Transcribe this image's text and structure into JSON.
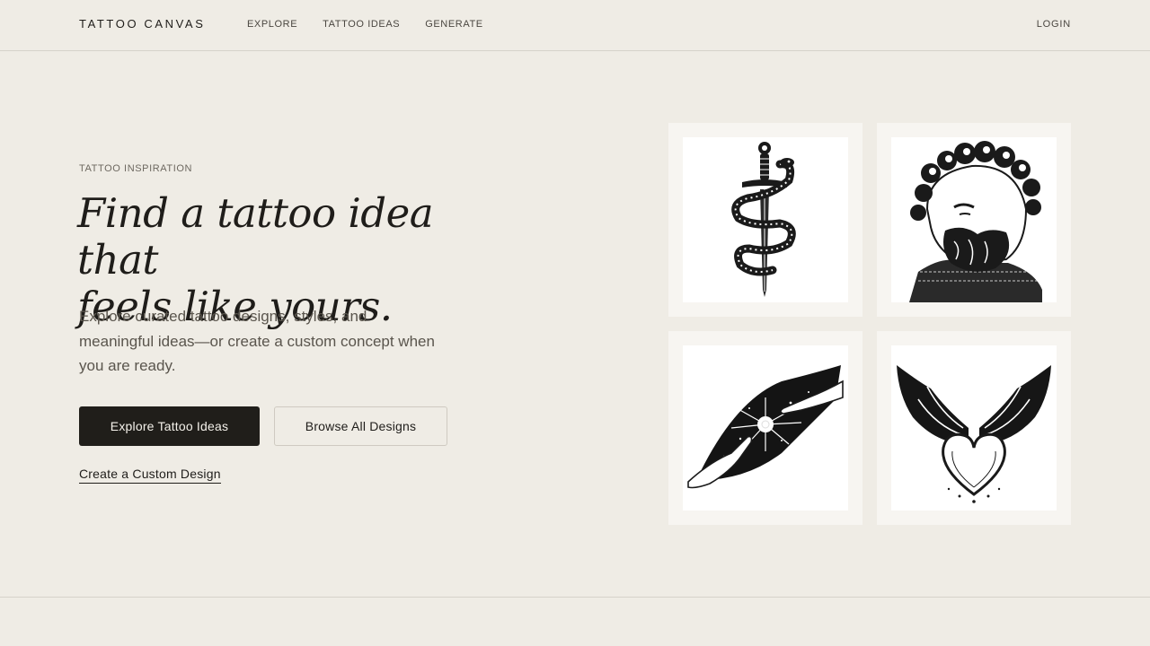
{
  "header": {
    "brand": "TATTOO CANVAS",
    "nav": [
      "EXPLORE",
      "TATTOO IDEAS",
      "GENERATE"
    ],
    "login": "LOGIN"
  },
  "hero": {
    "eyebrow": "TATTOO INSPIRATION",
    "headline_line1": "Find a tattoo idea that",
    "headline_line2": "feels like yours.",
    "lede": "Explore curated tattoo designs, styles, and meaningful ideas—or create a custom concept when you are ready.",
    "primary_cta": "Explore Tattoo Ideas",
    "secondary_cta": "Browse All Designs",
    "tertiary_link": "Create a Custom Design"
  },
  "gallery": {
    "images": [
      {
        "icon": "dagger-snake-icon"
      },
      {
        "icon": "greek-statue-head-icon"
      },
      {
        "icon": "reaching-hands-icon"
      },
      {
        "icon": "winged-heart-icon"
      }
    ]
  },
  "colors": {
    "background": "#efece5",
    "ink": "#1f1d1a",
    "primary_button": "#201e1a"
  }
}
